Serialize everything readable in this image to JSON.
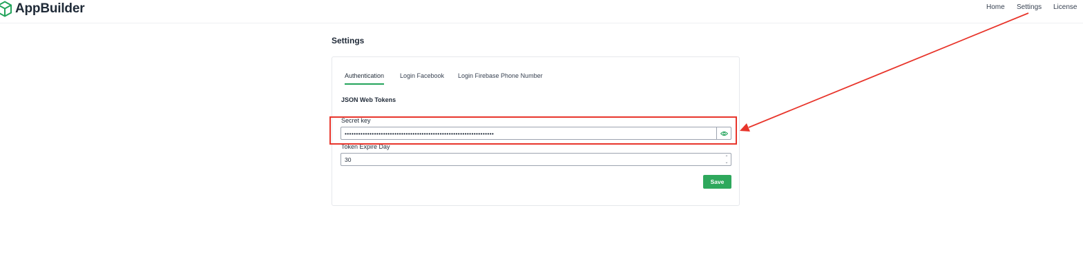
{
  "app": {
    "name": "AppBuilder",
    "brand_color": "#22a35a"
  },
  "nav": {
    "home": "Home",
    "settings": "Settings",
    "license": "License"
  },
  "page": {
    "title": "Settings"
  },
  "tabs": [
    {
      "label": "Authentication",
      "active": true
    },
    {
      "label": "Login Facebook",
      "active": false
    },
    {
      "label": "Login Firebase Phone Number",
      "active": false
    }
  ],
  "section": {
    "title": "JSON Web Tokens"
  },
  "fields": {
    "secret_key": {
      "label": "Secret key",
      "value": "••••••••••••••••••••••••••••••••••••••••••••••••••••••••••••••••••",
      "toggle_icon": "eye-icon"
    },
    "token_expire_day": {
      "label": "Token Expire Day",
      "value": "30"
    }
  },
  "actions": {
    "save_label": "Save",
    "save_color": "#2ea85c"
  },
  "annotation": {
    "color": "#e8352b"
  }
}
